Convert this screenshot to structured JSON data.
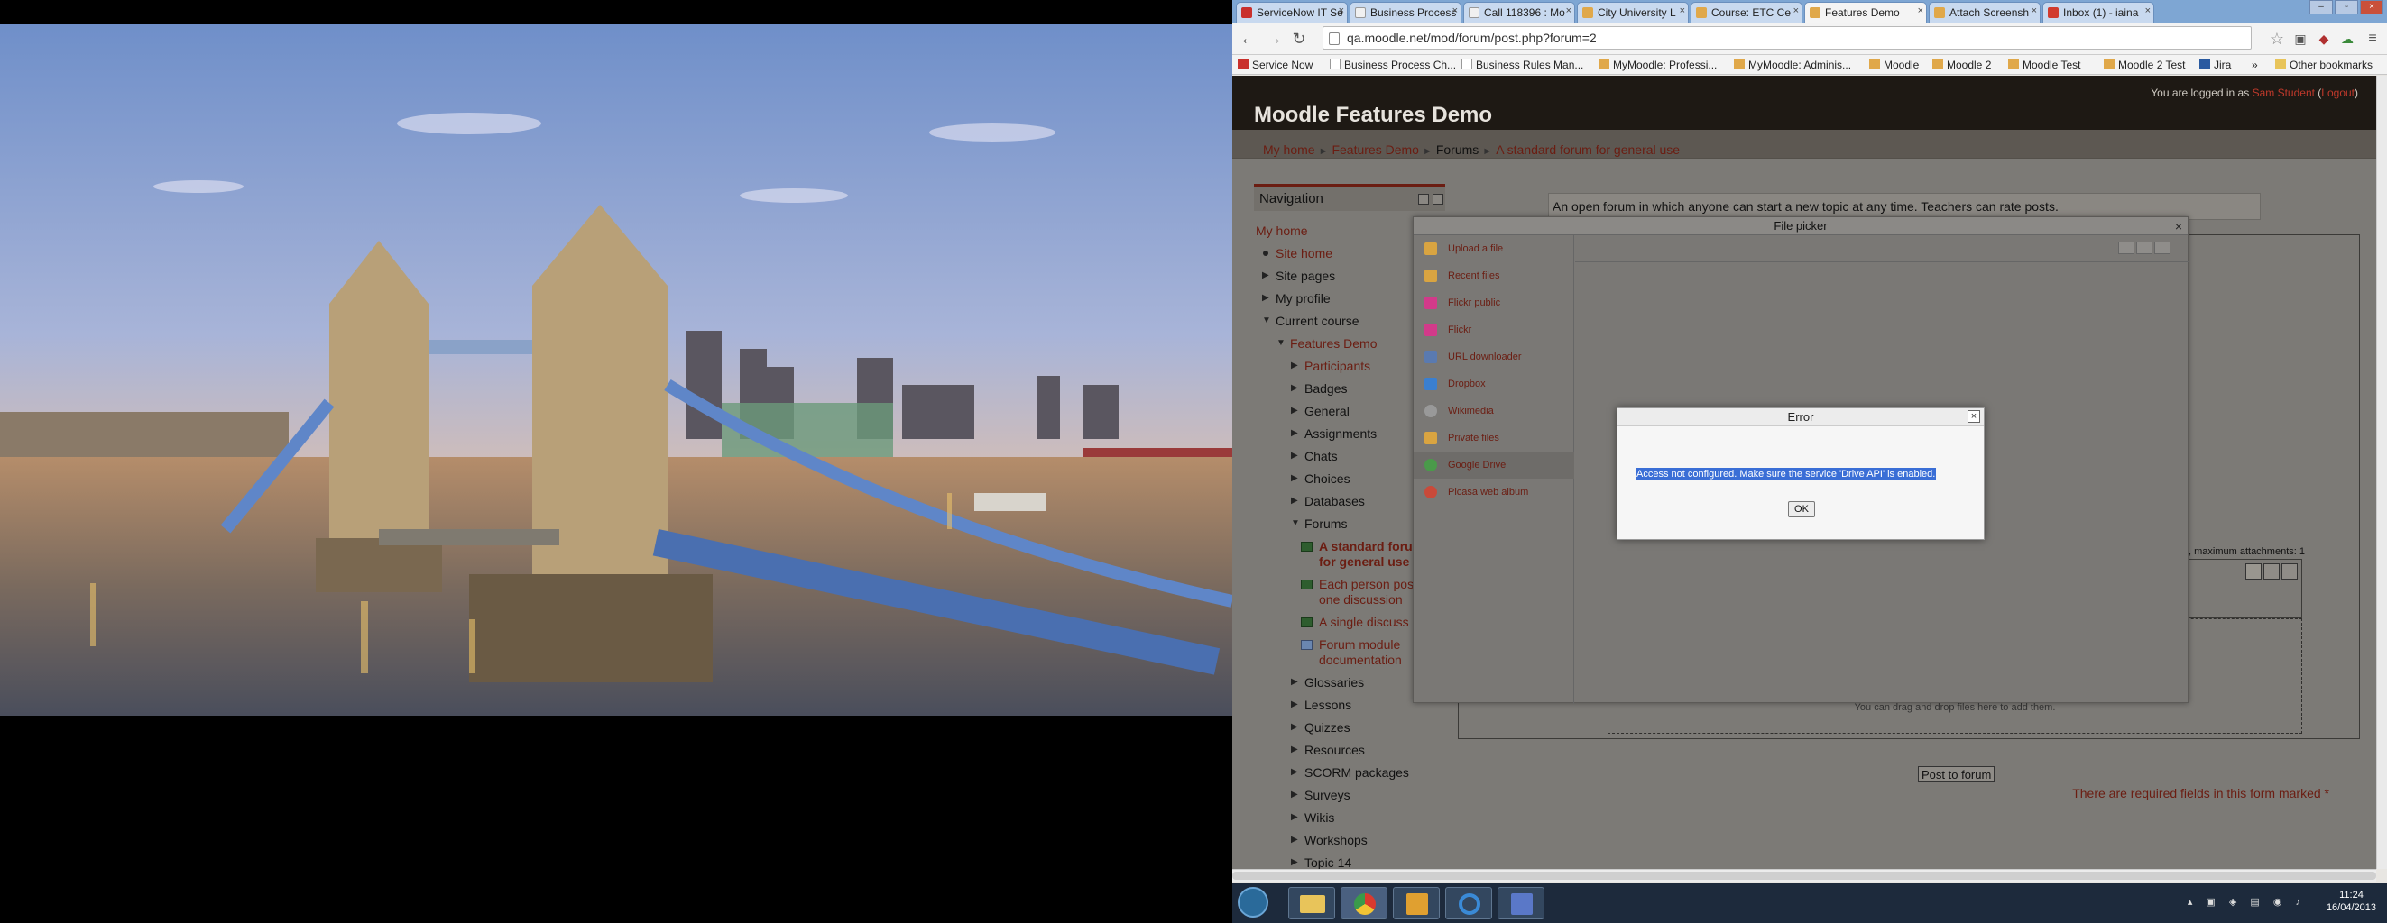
{
  "browser": {
    "tabs": [
      {
        "label": "ServiceNow IT Se",
        "color": "#c9302c"
      },
      {
        "label": "Business Process",
        "color": "#f0f0f0"
      },
      {
        "label": "Call 118396 : Mo",
        "color": "#f0f0f0"
      },
      {
        "label": "City University L",
        "color": "#e0a84a"
      },
      {
        "label": "Course: ETC Ce",
        "color": "#e0a84a"
      },
      {
        "label": "Features Demo",
        "color": "#e0a84a"
      },
      {
        "label": "Attach Screensh",
        "color": "#e0a84a"
      },
      {
        "label": "Inbox (1) - iaina",
        "color": "#d13b2e"
      }
    ],
    "url": "qa.moodle.net/mod/forum/post.php?forum=2",
    "bookmarks": [
      {
        "label": "Service Now",
        "icon": "servicenow-icon"
      },
      {
        "label": "Business Process Ch...",
        "icon": "page-icon"
      },
      {
        "label": "Business Rules Man...",
        "icon": "page-icon"
      },
      {
        "label": "MyMoodle: Professi...",
        "icon": "moodle-icon"
      },
      {
        "label": "MyMoodle: Adminis...",
        "icon": "moodle-icon"
      },
      {
        "label": "Moodle",
        "icon": "moodle-icon"
      },
      {
        "label": "Moodle 2",
        "icon": "moodle-icon"
      },
      {
        "label": "Moodle Test",
        "icon": "moodle-icon"
      },
      {
        "label": "Moodle 2 Test",
        "icon": "moodle-icon"
      },
      {
        "label": "Jira",
        "icon": "jira-icon"
      }
    ],
    "other_bookmarks": "Other bookmarks",
    "overflow": "»"
  },
  "moodle": {
    "site_title": "Moodle Features Demo",
    "login_prefix": "You are logged in as",
    "user": "Sam Student",
    "logout": "Logout",
    "breadcrumbs": [
      "My home",
      "Features Demo",
      "Forums",
      "A standard forum for general use"
    ],
    "nav_title": "Navigation",
    "nav": {
      "my_home": "My home",
      "site_home": "Site home",
      "site_pages": "Site pages",
      "my_profile": "My profile",
      "current_course": "Current course",
      "features_demo": "Features Demo",
      "participants": "Participants",
      "badges": "Badges",
      "general": "General",
      "assignments": "Assignments",
      "chats": "Chats",
      "choices": "Choices",
      "databases": "Databases",
      "forums": "Forums",
      "forum1a": "A standard foru",
      "forum1b": "for general use",
      "forum2a": "Each person pos",
      "forum2b": "one discussion",
      "forum3": "A single discuss",
      "forum4a": "Forum module",
      "forum4b": "documentation",
      "glossaries": "Glossaries",
      "lessons": "Lessons",
      "quizzes": "Quizzes",
      "resources": "Resources",
      "scorm": "SCORM packages",
      "surveys": "Surveys",
      "wikis": "Wikis",
      "workshops": "Workshops",
      "topic": "Topic 14"
    },
    "intro": "An open forum in which anyone can start a new topic at any time. Teachers can rate posts.",
    "max_attachments": ", maximum attachments: 1",
    "drop_hint": "You can drag and drop files here to add them.",
    "post_button": "Post to forum",
    "required_note": "There are required fields in this form marked",
    "required_mark": "*"
  },
  "file_picker": {
    "title": "File picker",
    "repositories": [
      {
        "label": "Upload a file",
        "icon": "upload-icon",
        "color": "#d9a441"
      },
      {
        "label": "Recent files",
        "icon": "recent-files-icon",
        "color": "#d9a441"
      },
      {
        "label": "Flickr public",
        "icon": "flickr-icon",
        "color": "#d23a8a"
      },
      {
        "label": "Flickr",
        "icon": "flickr-icon",
        "color": "#d23a8a"
      },
      {
        "label": "URL downloader",
        "icon": "url-icon",
        "color": "#5a7ab0"
      },
      {
        "label": "Dropbox",
        "icon": "dropbox-icon",
        "color": "#3a7fd0"
      },
      {
        "label": "Wikimedia",
        "icon": "wikimedia-icon",
        "color": "#999999"
      },
      {
        "label": "Private files",
        "icon": "private-files-icon",
        "color": "#d9a441"
      },
      {
        "label": "Google Drive",
        "icon": "google-drive-icon",
        "color": "#4a9a4a"
      },
      {
        "label": "Picasa web album",
        "icon": "picasa-icon",
        "color": "#c94a3a"
      }
    ],
    "selected_index": 8
  },
  "error_dialog": {
    "title": "Error",
    "message": "Access not configured. Make sure the service 'Drive API' is enabled.",
    "ok": "OK"
  },
  "taskbar": {
    "time": "11:24",
    "date": "16/04/2013"
  }
}
